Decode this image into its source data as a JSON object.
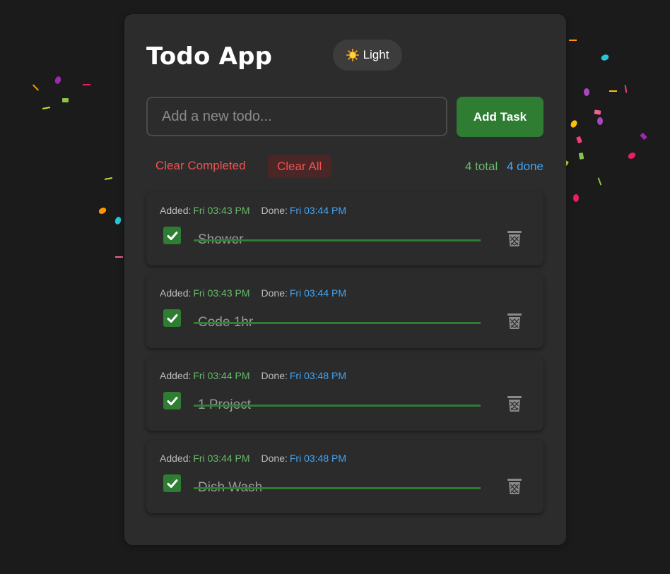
{
  "app": {
    "title": "Todo App",
    "theme_toggle_label": "Light"
  },
  "input": {
    "placeholder": "Add a new todo...",
    "value": ""
  },
  "add_button_label": "Add Task",
  "actions": {
    "clear_completed_label": "Clear Completed",
    "clear_all_label": "Clear All"
  },
  "stats": {
    "total": "4 total",
    "done": "4 done"
  },
  "todo_labels": {
    "added": "Added:",
    "done": "Done:"
  },
  "todos": [
    {
      "text": "Shower",
      "added": "Fri 03:43 PM",
      "done": "Fri 03:44 PM",
      "completed": true
    },
    {
      "text": "Code 1hr",
      "added": "Fri 03:43 PM",
      "done": "Fri 03:44 PM",
      "completed": true
    },
    {
      "text": "1 Project",
      "added": "Fri 03:44 PM",
      "done": "Fri 03:48 PM",
      "completed": true
    },
    {
      "text": "Dish Wash",
      "added": "Fri 03:44 PM",
      "done": "Fri 03:48 PM",
      "completed": true
    }
  ],
  "colors": {
    "background": "#1b1b1b",
    "card": "#2c2c2c",
    "accent_green": "#2e7d32",
    "added_green": "#66bb6a",
    "done_blue": "#42a5f5",
    "danger_red": "#ef5350",
    "confetti": [
      "#9c27b0",
      "#e91e63",
      "#8bc34a",
      "#cddc39",
      "#ff9800",
      "#26c6da",
      "#f06292",
      "#ab47bc",
      "#ffc107",
      "#ec407a"
    ]
  },
  "icons": {
    "theme": "sun-icon",
    "check": "check-icon",
    "delete": "trash-icon"
  }
}
